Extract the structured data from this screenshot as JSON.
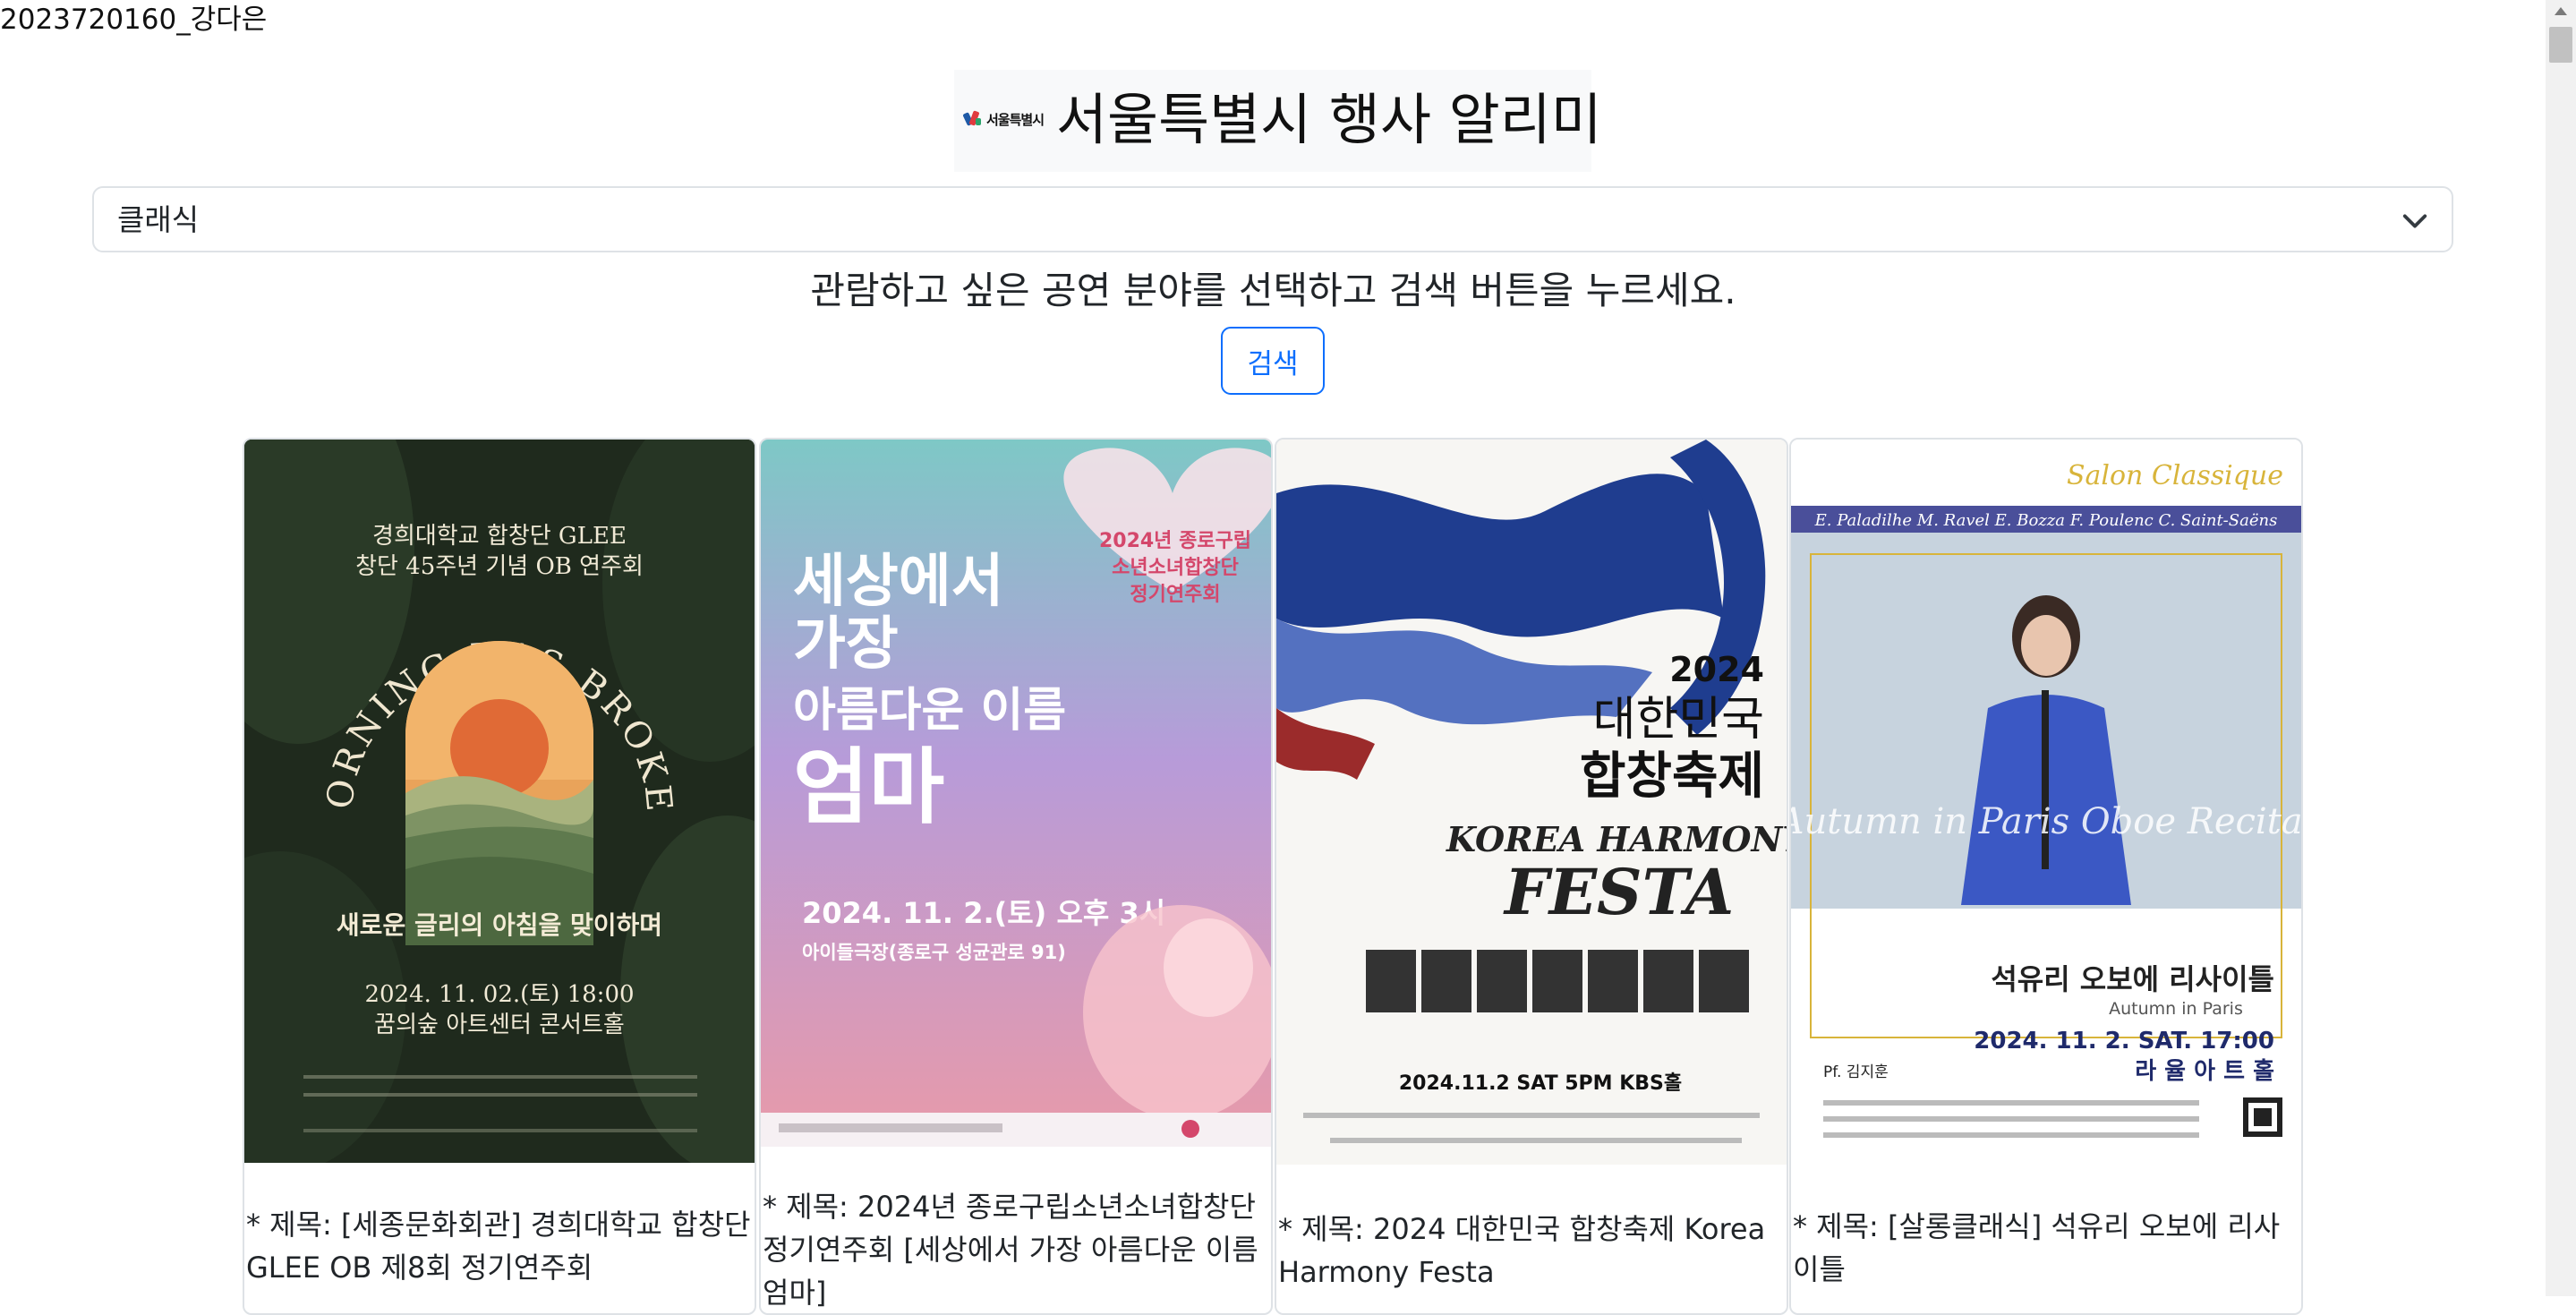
{
  "student_id": "2023720160_강다은",
  "header": {
    "logo_text": "서울특별시",
    "title": "서울특별시 행사 알리미"
  },
  "genre_select": {
    "selected": "클래식"
  },
  "instruction": "관람하고 싶은 공연 분야를 선택하고 검색 버튼을 누르세요.",
  "search_button": "검색",
  "cards": [
    {
      "title": "* 제목: [세종문화회관] 경희대학교 합창단 GLEE OB 제8회 정기연주회",
      "poster": {
        "line1": "경희대학교 합창단 GLEE",
        "line2": "창단 45주년 기념 OB 연주회",
        "arc": "MORNING HAS BROKEN",
        "tagline": "새로운 글리의 아침을 맞이하며",
        "date": "2024. 11. 02.(토) 18:00",
        "venue": "꿈의숲 아트센터 콘서트홀"
      }
    },
    {
      "title": "* 제목: 2024년 종로구립소년소녀합창단 정기연주회 [세상에서 가장 아름다운 이름 엄마]",
      "poster": {
        "heart_lines": [
          "2024년 종로구립",
          "소년소녀합창단",
          "정기연주회"
        ],
        "headline": [
          "세상에서",
          "가장",
          "아름다운 이름",
          "엄마"
        ],
        "date": "2024. 11. 2.(토) 오후 3시",
        "venue": "아이들극장(종로구 성균관로 91)"
      }
    },
    {
      "title": "* 제목: 2024 대한민국 합창축제 Korea Harmony Festa",
      "poster": {
        "year": "2024",
        "name1": "대한민국",
        "name2": "합창축제",
        "sub1": "KOREA HARMONY",
        "sub2": "FESTA",
        "date": "2024.11.2 SAT 5PM KBS홀"
      }
    },
    {
      "title": "* 제목: [살롱클래식] 석유리 오보에 리사이틀",
      "poster": {
        "series": "Salon Classique",
        "composers": "E. Paladilhe   M. Ravel   E. Bozza   F. Poulenc   C. Saint-Saëns",
        "script": "Autumn in Paris  Oboe Recital",
        "name": "석유리 오보에 리사이틀",
        "sub": "Autumn in Paris",
        "date": "2024. 11. 2. SAT. 17:00",
        "venue": "라 율 아 트 홀",
        "pianist": "Pf. 김지훈"
      }
    }
  ],
  "colors": {
    "primary": "#0d6efd",
    "border": "#dee2e6",
    "header_bg": "#f8f9fa"
  }
}
